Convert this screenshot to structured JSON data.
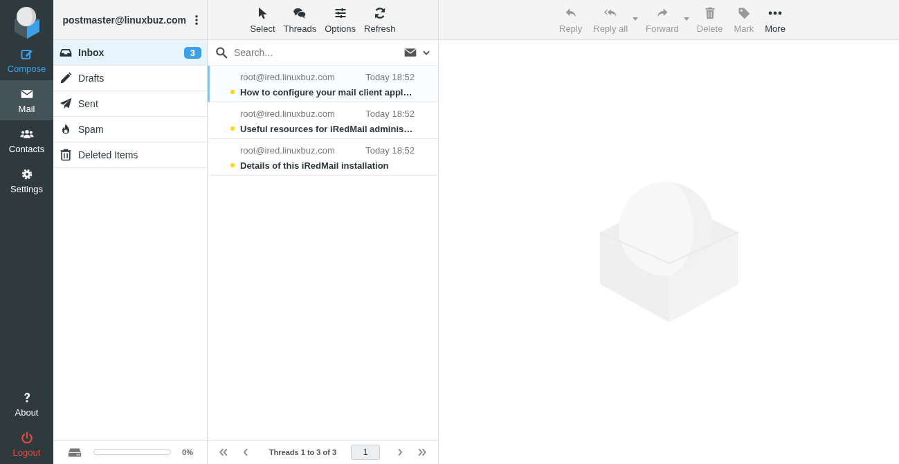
{
  "rail": {
    "items": [
      {
        "label": "Compose",
        "kind": "compose",
        "selected": false
      },
      {
        "label": "Mail",
        "kind": "mail",
        "selected": true
      },
      {
        "label": "Contacts",
        "kind": "contacts",
        "selected": false
      },
      {
        "label": "Settings",
        "kind": "settings",
        "selected": false
      }
    ],
    "bottom_items": [
      {
        "label": "About",
        "kind": "about"
      },
      {
        "label": "Logout",
        "kind": "logout"
      }
    ]
  },
  "account": "postmaster@linuxbuz.com",
  "folders": [
    {
      "label": "Inbox",
      "kind": "inbox",
      "selected": true,
      "unread": "3"
    },
    {
      "label": "Drafts",
      "kind": "drafts",
      "selected": false
    },
    {
      "label": "Sent",
      "kind": "sent",
      "selected": false
    },
    {
      "label": "Spam",
      "kind": "spam",
      "selected": false
    },
    {
      "label": "Deleted Items",
      "kind": "trash",
      "selected": false
    }
  ],
  "quota": {
    "level": 0,
    "reading": "0%"
  },
  "list_toolbar": [
    {
      "label": "Select",
      "kind": "select"
    },
    {
      "label": "Threads",
      "kind": "threads"
    },
    {
      "label": "Options",
      "kind": "options"
    },
    {
      "label": "Refresh",
      "kind": "refresh"
    }
  ],
  "search": {
    "placeholder": "Search..."
  },
  "messages": [
    {
      "from": "root@ired.linuxbuz.com",
      "date": "Today 18:52",
      "subject": "How to configure your mail client appl…",
      "unread": true,
      "selected": true
    },
    {
      "from": "root@ired.linuxbuz.com",
      "date": "Today 18:52",
      "subject": "Useful resources for iRedMail adminis…",
      "unread": true,
      "selected": false
    },
    {
      "from": "root@ired.linuxbuz.com",
      "date": "Today 18:52",
      "subject": "Details of this iRedMail installation",
      "unread": true,
      "selected": false
    }
  ],
  "pagination": {
    "label": "Threads 1 to 3 of 3",
    "page": "1"
  },
  "preview_toolbar": [
    {
      "label": "Reply",
      "kind": "reply",
      "disabled": true,
      "dropdown": false
    },
    {
      "label": "Reply all",
      "kind": "replyall",
      "disabled": true,
      "dropdown": true
    },
    {
      "label": "Forward",
      "kind": "forward",
      "disabled": true,
      "dropdown": true
    },
    {
      "label": "Delete",
      "kind": "delete",
      "disabled": true,
      "dropdown": false
    },
    {
      "label": "Mark",
      "kind": "mark",
      "disabled": true,
      "dropdown": false
    },
    {
      "label": "More",
      "kind": "more",
      "disabled": false,
      "dropdown": false
    }
  ]
}
